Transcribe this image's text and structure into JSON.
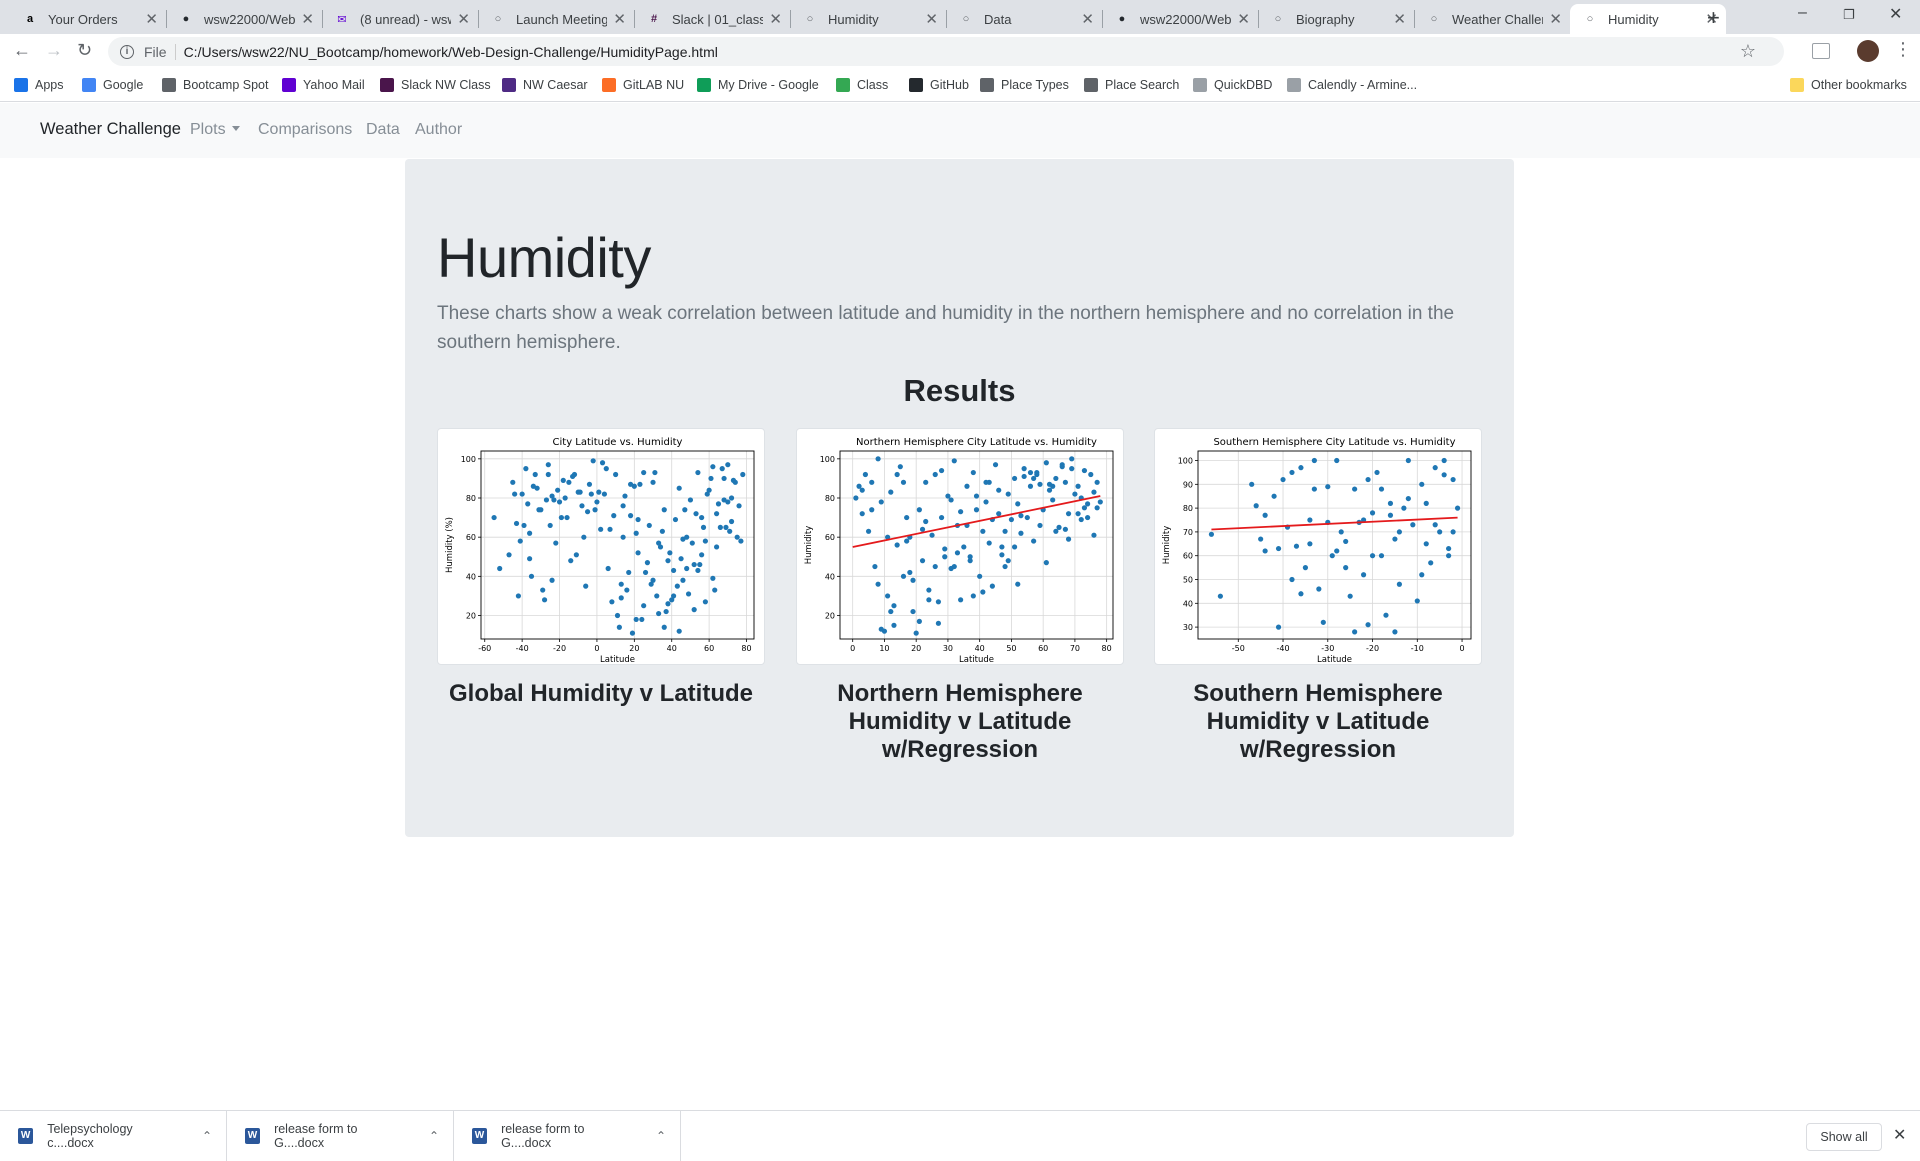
{
  "browser": {
    "tabs": [
      {
        "title": "Your Orders",
        "icon": "amazon-icon"
      },
      {
        "title": "wsw22000/Web-",
        "icon": "github-icon"
      },
      {
        "title": "(8 unread) - wsw",
        "icon": "yahoo-mail-icon"
      },
      {
        "title": "Launch Meeting",
        "icon": "globe-icon"
      },
      {
        "title": "Slack | 01_class_a",
        "icon": "slack-icon"
      },
      {
        "title": "Humidity",
        "icon": "globe-icon"
      },
      {
        "title": "Data",
        "icon": "globe-icon"
      },
      {
        "title": "wsw22000/Web-",
        "icon": "github-icon"
      },
      {
        "title": "Biography",
        "icon": "globe-icon"
      },
      {
        "title": "Weather Challen",
        "icon": "globe-icon"
      },
      {
        "title": "Humidity",
        "icon": "globe-icon",
        "active": true
      }
    ],
    "address": {
      "scheme": "File",
      "url": "C:/Users/wsw22/NU_Bootcamp/homework/Web-Design-Challenge/HumidityPage.html"
    },
    "bookmarks": [
      {
        "label": "Apps",
        "icon": "apps-grid-icon",
        "color": "#1a73e8"
      },
      {
        "label": "Google",
        "icon": "google-icon",
        "color": "#4285f4"
      },
      {
        "label": "Bootcamp Spot",
        "icon": "globe-icon",
        "color": "#5f6368"
      },
      {
        "label": "Yahoo Mail",
        "icon": "yahoo-mail-icon",
        "color": "#6001d2"
      },
      {
        "label": "Slack NW Class",
        "icon": "slack-icon",
        "color": "#4a154b"
      },
      {
        "label": "NW Caesar",
        "icon": "northwestern-icon",
        "color": "#4e2a84"
      },
      {
        "label": "GitLAB NU",
        "icon": "gitlab-icon",
        "color": "#fc6d26"
      },
      {
        "label": "My Drive - Google",
        "icon": "drive-icon",
        "color": "#0f9d58"
      },
      {
        "label": "Class",
        "icon": "class-icon",
        "color": "#34a853"
      },
      {
        "label": "GitHub",
        "icon": "github-icon",
        "color": "#24292e"
      },
      {
        "label": "Place Types",
        "icon": "code-icon",
        "color": "#5f6368"
      },
      {
        "label": "Place Search",
        "icon": "code-icon",
        "color": "#5f6368"
      },
      {
        "label": "QuickDBD",
        "icon": "bolt-icon",
        "color": "#9aa0a6"
      },
      {
        "label": "Calendly - Armine...",
        "icon": "calendar-icon",
        "color": "#9aa0a6"
      }
    ],
    "other_bookmarks": "Other bookmarks"
  },
  "nav": {
    "brand": "Weather Challenge",
    "plots": "Plots",
    "comparisons": "Comparisons",
    "data": "Data",
    "author": "Author"
  },
  "page": {
    "title": "Humidity",
    "lead": "These charts show a weak correlation between latitude and humidity in the northern hemisphere and no correlation in the southern hemisphere.",
    "results_heading": "Results",
    "captions": [
      "Global Humidity v Latitude",
      "Northern Hemisphere Humidity v Latitude w/Regression",
      "Southern Hemisphere Humidity v Latitude w/Regression"
    ]
  },
  "chart_data": [
    {
      "type": "scatter",
      "title": "City Latitude vs. Humidity",
      "xlabel": "Latitude",
      "ylabel": "Humidity (%)",
      "xlim": [
        -62,
        84
      ],
      "ylim": [
        8,
        104
      ],
      "xticks": [
        -60,
        -40,
        -20,
        0,
        20,
        40,
        60,
        80
      ],
      "yticks": [
        20,
        40,
        60,
        80,
        100
      ],
      "grid": true,
      "point_color": "#1f77b4",
      "x": [
        -55,
        -52,
        -45,
        -42,
        -40,
        -38,
        -36,
        -35,
        -33,
        -32,
        -30,
        -28,
        -26,
        -25,
        -24,
        -22,
        -20,
        -18,
        -16,
        -14,
        -12,
        -10,
        -8,
        -6,
        -4,
        -2,
        0,
        2,
        4,
        6,
        8,
        10,
        12,
        14,
        16,
        18,
        20,
        22,
        24,
        26,
        28,
        30,
        32,
        34,
        36,
        38,
        40,
        42,
        44,
        46,
        48,
        50,
        52,
        54,
        56,
        58,
        60,
        62,
        64,
        66,
        68,
        70,
        72,
        74,
        76,
        78,
        -43,
        -37,
        -29,
        -21,
        -13,
        -5,
        3,
        11,
        19,
        27,
        35,
        43,
        51,
        59,
        67,
        75,
        -47,
        -39,
        -31,
        -23,
        -15,
        -7,
        1,
        9,
        17,
        25,
        33,
        41,
        49,
        57,
        65,
        73,
        -41,
        -34,
        -27,
        -19,
        -11,
        -3,
        5,
        13,
        21,
        29,
        37,
        45,
        53,
        61,
        69,
        77,
        -36,
        -24,
        -9,
        7,
        15,
        23,
        31,
        39,
        47,
        55,
        63,
        71,
        -44,
        -26,
        -17,
        -1,
        14,
        22,
        30,
        38,
        46,
        54,
        62,
        70,
        18,
        25,
        33,
        41,
        48,
        56,
        13,
        21,
        36,
        44,
        52,
        58,
        64,
        68,
        72
      ],
      "y": [
        70,
        44,
        88,
        30,
        82,
        95,
        62,
        40,
        92,
        85,
        74,
        28,
        97,
        66,
        81,
        57,
        78,
        89,
        70,
        48,
        92,
        83,
        76,
        35,
        87,
        99,
        78,
        64,
        82,
        44,
        27,
        92,
        14,
        60,
        33,
        71,
        86,
        52,
        18,
        42,
        66,
        88,
        30,
        55,
        74,
        48,
        28,
        69,
        85,
        38,
        60,
        79,
        46,
        93,
        70,
        58,
        84,
        96,
        72,
        65,
        90,
        97,
        80,
        88,
        76,
        92,
        67,
        77,
        33,
        84,
        91,
        73,
        98,
        20,
        11,
        47,
        63,
        35,
        57,
        82,
        95,
        60,
        51,
        66,
        74,
        79,
        88,
        60,
        83,
        71,
        42,
        25,
        57,
        43,
        31,
        65,
        77,
        89,
        58,
        86,
        79,
        70,
        51,
        82,
        95,
        29,
        18,
        36,
        22,
        49,
        72,
        90,
        65,
        58,
        49,
        38,
        83,
        64,
        81,
        87,
        93,
        52,
        74,
        46,
        33,
        63,
        82,
        92,
        80,
        74,
        76,
        69,
        38,
        26,
        59,
        43,
        39,
        78,
        87,
        93,
        21,
        30,
        44,
        51,
        36,
        62,
        14,
        12,
        23,
        27,
        55,
        79,
        68,
        100,
        84,
        91
      ],
      "count_note": "about 540 points; values read approximately"
    },
    {
      "type": "scatter",
      "title": "Northern Hemisphere City Latitude vs. Humidity",
      "xlabel": "Latitude",
      "ylabel": "Humidity",
      "xlim": [
        -4,
        82
      ],
      "ylim": [
        8,
        104
      ],
      "xticks": [
        0,
        10,
        20,
        30,
        40,
        50,
        60,
        70,
        80
      ],
      "yticks": [
        20,
        40,
        60,
        80,
        100
      ],
      "grid": true,
      "point_color": "#1f77b4",
      "regression": {
        "color": "#e41a1c",
        "x": [
          0,
          78
        ],
        "y": [
          55,
          81
        ]
      },
      "x": [
        1,
        2,
        3,
        4,
        5,
        6,
        7,
        8,
        9,
        10,
        11,
        12,
        13,
        14,
        15,
        16,
        17,
        18,
        19,
        20,
        21,
        22,
        23,
        24,
        25,
        26,
        27,
        28,
        29,
        30,
        31,
        32,
        33,
        34,
        35,
        36,
        37,
        38,
        39,
        40,
        41,
        42,
        43,
        44,
        45,
        46,
        47,
        48,
        49,
        50,
        51,
        52,
        53,
        54,
        55,
        56,
        57,
        58,
        59,
        60,
        61,
        62,
        63,
        64,
        65,
        66,
        67,
        68,
        69,
        70,
        71,
        72,
        73,
        74,
        75,
        76,
        77,
        78,
        3,
        8,
        13,
        18,
        23,
        28,
        33,
        38,
        43,
        48,
        53,
        58,
        63,
        68,
        73,
        6,
        11,
        16,
        21,
        26,
        31,
        36,
        41,
        46,
        51,
        56,
        61,
        66,
        71,
        76,
        9,
        14,
        19,
        24,
        29,
        34,
        39,
        44,
        49,
        54,
        59,
        64,
        69,
        74,
        12,
        17,
        22,
        27,
        32,
        37,
        42,
        47,
        52,
        57,
        62,
        67,
        72,
        77
      ],
      "y": [
        80,
        86,
        72,
        92,
        63,
        88,
        45,
        100,
        78,
        12,
        30,
        83,
        15,
        56,
        96,
        40,
        70,
        60,
        22,
        11,
        74,
        48,
        88,
        33,
        61,
        92,
        27,
        70,
        50,
        81,
        44,
        99,
        66,
        28,
        55,
        86,
        48,
        93,
        74,
        40,
        63,
        88,
        57,
        35,
        97,
        72,
        51,
        45,
        82,
        69,
        90,
        77,
        62,
        95,
        70,
        86,
        58,
        92,
        66,
        74,
        98,
        84,
        79,
        90,
        65,
        96,
        88,
        72,
        100,
        82,
        86,
        80,
        94,
        70,
        92,
        83,
        88,
        78,
        84,
        36,
        25,
        42,
        68,
        94,
        52,
        30,
        88,
        63,
        71,
        93,
        86,
        59,
        75,
        74,
        60,
        88,
        17,
        45,
        79,
        66,
        32,
        84,
        55,
        93,
        47,
        97,
        72,
        61,
        13,
        92,
        38,
        28,
        54,
        73,
        81,
        69,
        48,
        91,
        87,
        63,
        95,
        77,
        22,
        58,
        64,
        16,
        45,
        50,
        78,
        55,
        36,
        90,
        87,
        64,
        69,
        75,
        96
      ],
      "count_note": "about 380 points; values read approximately"
    },
    {
      "type": "scatter",
      "title": "Southern Hemisphere City Latitude vs. Humidity",
      "xlabel": "Latitude",
      "ylabel": "Humidity",
      "xlim": [
        -59,
        2
      ],
      "ylim": [
        25,
        104
      ],
      "xticks": [
        -50,
        -40,
        -30,
        -20,
        -10,
        0
      ],
      "yticks": [
        30,
        40,
        50,
        60,
        70,
        80,
        90,
        100
      ],
      "grid": true,
      "point_color": "#1f77b4",
      "regression": {
        "color": "#e41a1c",
        "x": [
          -56,
          -1
        ],
        "y": [
          71,
          76
        ]
      },
      "x": [
        -56,
        -54,
        -47,
        -46,
        -45,
        -44,
        -42,
        -41,
        -40,
        -39,
        -38,
        -37,
        -36,
        -35,
        -34,
        -33,
        -32,
        -31,
        -30,
        -29,
        -28,
        -27,
        -26,
        -25,
        -24,
        -23,
        -22,
        -21,
        -20,
        -19,
        -18,
        -17,
        -16,
        -15,
        -14,
        -13,
        -12,
        -11,
        -10,
        -9,
        -8,
        -7,
        -6,
        -5,
        -4,
        -3,
        -2,
        -1,
        -44,
        -38,
        -34,
        -26,
        -22,
        -18,
        -14,
        -8,
        -4,
        -2,
        -41,
        -36,
        -30,
        -24,
        -20,
        -16,
        -12,
        -6,
        -3,
        -33,
        -28,
        -21,
        -15,
        -9
      ],
      "y": [
        69,
        43,
        90,
        81,
        67,
        62,
        85,
        30,
        92,
        72,
        50,
        64,
        97,
        55,
        75,
        100,
        46,
        32,
        89,
        60,
        100,
        70,
        66,
        43,
        88,
        74,
        52,
        31,
        78,
        95,
        60,
        35,
        82,
        67,
        48,
        80,
        100,
        73,
        41,
        90,
        65,
        57,
        97,
        70,
        100,
        60,
        92,
        80,
        77,
        95,
        65,
        55,
        75,
        88,
        70,
        82,
        94,
        70,
        63,
        44,
        74,
        28,
        60,
        77,
        84,
        73,
        63,
        88,
        62,
        92,
        28,
        52,
        79
      ],
      "count_note": "about 160 points; values read approximately"
    }
  ],
  "downloads": [
    {
      "name": "Telepsychology c....docx"
    },
    {
      "name": "release form to G....docx"
    },
    {
      "name": "release form to G....docx"
    }
  ],
  "show_all": "Show all"
}
